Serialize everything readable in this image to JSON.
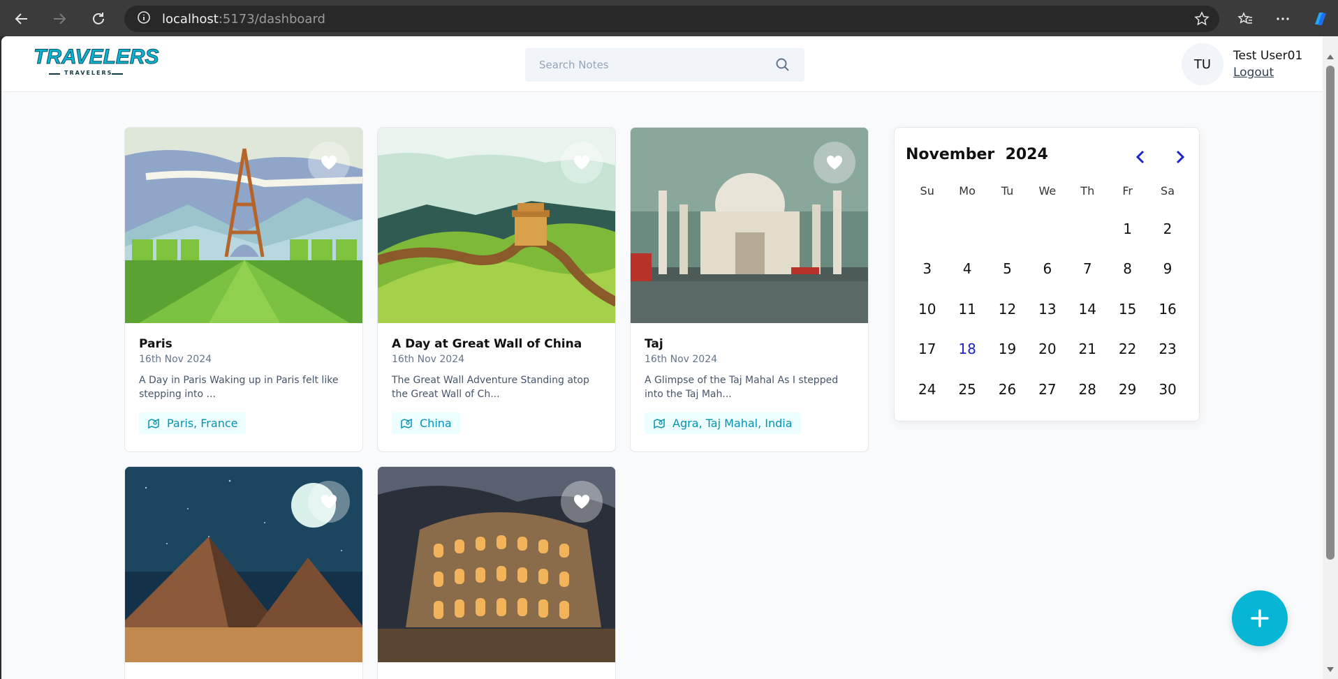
{
  "browser": {
    "url_host": "localhost",
    "url_path": ":5173/dashboard"
  },
  "app": {
    "logo_text": "TRAVELERS",
    "logo_sub": "TRAVELERS"
  },
  "search": {
    "placeholder": "Search Notes"
  },
  "user": {
    "initials": "TU",
    "name": "Test User01",
    "logout_label": "Logout"
  },
  "stories": [
    {
      "title": "Paris",
      "date": "16th Nov 2024",
      "excerpt": "A Day in Paris Waking up in Paris felt like stepping into ...",
      "location": "Paris, France",
      "image": "eiffel-tower-illustration"
    },
    {
      "title": "A Day at Great Wall of China",
      "date": "16th Nov 2024",
      "excerpt": "The Great Wall Adventure Standing atop the Great Wall of Ch...",
      "location": "China",
      "image": "great-wall-illustration"
    },
    {
      "title": "Taj",
      "date": "16th Nov 2024",
      "excerpt": "A Glimpse of the Taj Mahal As I stepped into the Taj Mah...",
      "location": "Agra, Taj Mahal, India",
      "image": "taj-mahal-painting"
    },
    {
      "image": "pyramids-night"
    },
    {
      "image": "colosseum-night"
    }
  ],
  "calendar": {
    "month": "November",
    "year": "2024",
    "weekdays": [
      "Su",
      "Mo",
      "Tu",
      "We",
      "Th",
      "Fr",
      "Sa"
    ],
    "weeks": [
      [
        "",
        "",
        "",
        "",
        "",
        "1",
        "2"
      ],
      [
        "3",
        "4",
        "5",
        "6",
        "7",
        "8",
        "9"
      ],
      [
        "10",
        "11",
        "12",
        "13",
        "14",
        "15",
        "16"
      ],
      [
        "17",
        "18",
        "19",
        "20",
        "21",
        "22",
        "23"
      ],
      [
        "24",
        "25",
        "26",
        "27",
        "28",
        "29",
        "30"
      ]
    ],
    "selected_day": "18"
  },
  "colors": {
    "accent": "#06b6d4",
    "calendar_nav": "#1d24c9"
  }
}
